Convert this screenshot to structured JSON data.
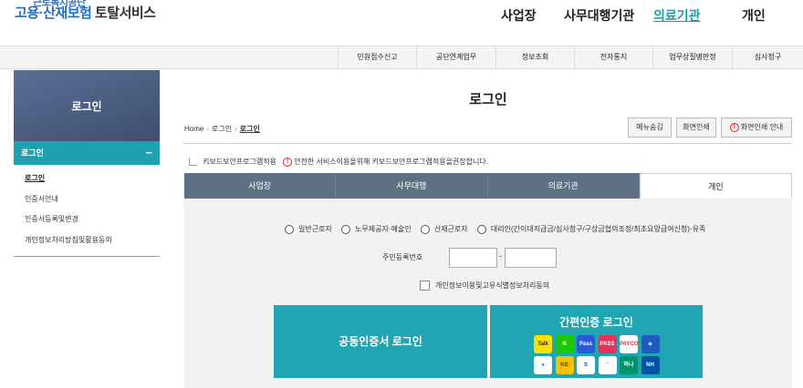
{
  "header": {
    "logo_top": "근로복지공단",
    "logo_main": "고용·산재보험",
    "logo_sub": "토탈서비스"
  },
  "gnb": [
    "사업장",
    "사무대행기관",
    "의료기관",
    "개인"
  ],
  "subnav": [
    "민원접수신고",
    "공단연계업무",
    "정보조회",
    "전자통지",
    "업무상질병판정",
    "심사청구"
  ],
  "lnb": {
    "title": "로그인",
    "section": "로그인",
    "items": [
      "로그인",
      "인증서안내",
      "인증서등록및변경",
      "개인정보처리방침및활용동의"
    ]
  },
  "page_title": "로그인",
  "breadcrumb": [
    "Home",
    "로그인",
    "로그인"
  ],
  "tools": {
    "hide_menu": "메뉴숨김",
    "print": "화면인쇄",
    "print_guide": "화면인쇄 안내"
  },
  "security": {
    "label": "키보드보안프로그램적용",
    "warning": "안전한 서비스이용을위해 키보드보안프로그램적용을권장합니다."
  },
  "tabs": [
    "사업장",
    "사무대행",
    "의료기관",
    "개인"
  ],
  "radios": [
    "일반근로자",
    "노무제공자·예술인",
    "산재근로자",
    "대리인(간이대지급금/심사청구/구상금협의조정/최초요양급여신청)·유족"
  ],
  "ssn_label": "주민등록번호",
  "agree_label": "개인정보이용및고유식별정보처리동의",
  "cert_login": "공동인증서 로그인",
  "simple_login": "간편인증 로그인",
  "simple_providers": [
    {
      "name": "kakao-icon",
      "label": "Talk",
      "bg": "#f9e000",
      "fg": "#3a1d1d"
    },
    {
      "name": "naver-icon",
      "label": "N",
      "bg": "#1ec800",
      "fg": "#ffffff"
    },
    {
      "name": "toss-pass-icon",
      "label": "Pass",
      "bg": "#2a5bd7",
      "fg": "#ffffff"
    },
    {
      "name": "pass-icon",
      "label": "PASS",
      "bg": "#e8315a",
      "fg": "#ffffff"
    },
    {
      "name": "payco-icon",
      "label": "PAYCO",
      "bg": "#ffffff",
      "fg": "#e8263a"
    },
    {
      "name": "shield-icon",
      "label": "◈",
      "bg": "#1f5bbf",
      "fg": "#ffffff"
    },
    {
      "name": "samsung-icon",
      "label": "●",
      "bg": "#ffffff",
      "fg": "#1a73e8"
    },
    {
      "name": "kb-icon",
      "label": "KB",
      "bg": "#f5c400",
      "fg": "#5a4a2a"
    },
    {
      "name": "shinhan-icon",
      "label": "S",
      "bg": "#ffffff",
      "fg": "#1a4fa0"
    },
    {
      "name": "woori-icon",
      "label": "◠",
      "bg": "#ffffff",
      "fg": "#1aa0d8"
    },
    {
      "name": "hana-icon",
      "label": "하나",
      "bg": "#00936b",
      "fg": "#ffffff"
    },
    {
      "name": "nh-icon",
      "label": "NH",
      "bg": "#0053a6",
      "fg": "#ffffff"
    }
  ]
}
